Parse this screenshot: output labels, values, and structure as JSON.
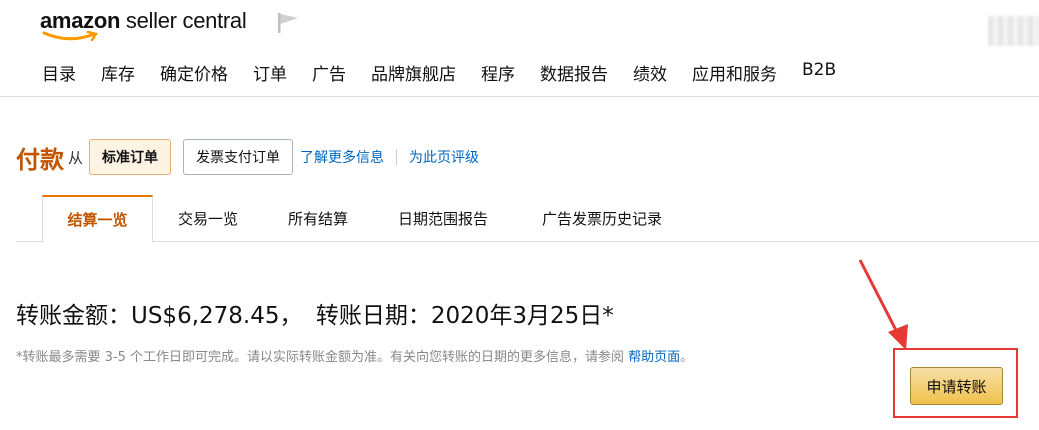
{
  "header": {
    "logo": {
      "brand": "amazon",
      "product": "seller central"
    },
    "nav": [
      "目录",
      "库存",
      "确定价格",
      "订单",
      "广告",
      "品牌旗舰店",
      "程序",
      "数据报告",
      "绩效",
      "应用和服务",
      "B2B"
    ]
  },
  "page": {
    "title": "付款",
    "from_label": "从",
    "standard_orders_label": "标准订单",
    "invoiced_orders_label": "发票支付订单",
    "learn_more_link": "了解更多信息",
    "rate_page_link": "为此页评级"
  },
  "tabs": [
    "结算一览",
    "交易一览",
    "所有结算",
    "日期范围报告",
    "广告发票历史记录"
  ],
  "transfer": {
    "amount_label": "转账金额：",
    "amount": "US$6,278.45，",
    "date_label": "转账日期：",
    "date": "2020年3月25日*",
    "note": "*转账最多需要 3-5 个工作日即可完成。请以实际转账金额为准。有关向您转账的日期的更多信息，请参阅",
    "help_link": "帮助页面",
    "note_end": "。",
    "request_button": "申请转账"
  },
  "colors": {
    "title": "#c45500",
    "link": "#0066c0",
    "tab_active_border": "#e77600",
    "highlight": "#e53935",
    "button_yellow": "#f0c14b"
  }
}
